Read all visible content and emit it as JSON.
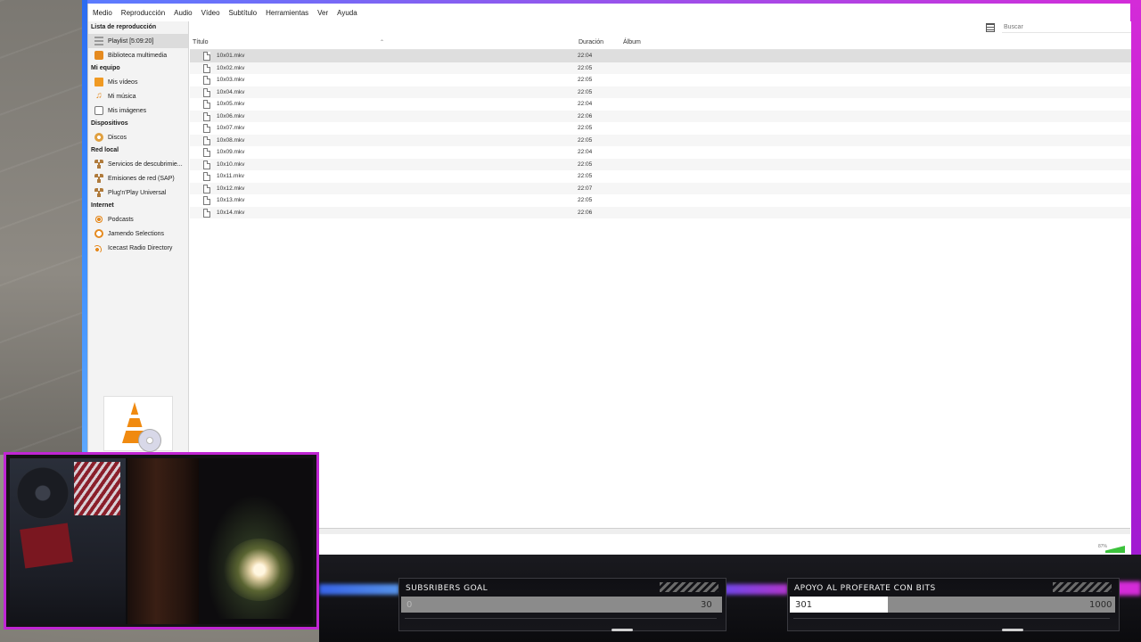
{
  "menubar": [
    "Medio",
    "Reproducción",
    "Audio",
    "Vídeo",
    "Subtítulo",
    "Herramientas",
    "Ver",
    "Ayuda"
  ],
  "sidebar": {
    "sections": [
      {
        "title": "Lista de reproducción",
        "items": [
          {
            "label": "Playlist [5:09:20]",
            "icon": "playlist-icon",
            "selected": true
          },
          {
            "label": "Biblioteca multimedia",
            "icon": "library-icon",
            "selected": false
          }
        ]
      },
      {
        "title": "Mi equipo",
        "items": [
          {
            "label": "Mis vídeos",
            "icon": "videos-icon"
          },
          {
            "label": "Mi música",
            "icon": "music-icon"
          },
          {
            "label": "Mis imágenes",
            "icon": "images-icon"
          }
        ]
      },
      {
        "title": "Dispositivos",
        "items": [
          {
            "label": "Discos",
            "icon": "disc-icon"
          }
        ]
      },
      {
        "title": "Red local",
        "items": [
          {
            "label": "Servicios de descubrimie...",
            "icon": "network-icon"
          },
          {
            "label": "Emisiones de red (SAP)",
            "icon": "network-icon"
          },
          {
            "label": "Plug'n'Play Universal",
            "icon": "network-icon"
          }
        ]
      },
      {
        "title": "Internet",
        "items": [
          {
            "label": "Podcasts",
            "icon": "podcast-icon"
          },
          {
            "label": "Jamendo Selections",
            "icon": "jamendo-icon"
          },
          {
            "label": "Icecast Radio Directory",
            "icon": "icecast-icon"
          }
        ]
      }
    ]
  },
  "search": {
    "placeholder": "Buscar"
  },
  "columns": {
    "title": "Título",
    "duration": "Duración",
    "album": "Álbum"
  },
  "playlist": [
    {
      "title": "10x01.mkv",
      "duration": "22:04"
    },
    {
      "title": "10x02.mkv",
      "duration": "22:05"
    },
    {
      "title": "10x03.mkv",
      "duration": "22:05"
    },
    {
      "title": "10x04.mkv",
      "duration": "22:05"
    },
    {
      "title": "10x05.mkv",
      "duration": "22:04"
    },
    {
      "title": "10x06.mkv",
      "duration": "22:06"
    },
    {
      "title": "10x07.mkv",
      "duration": "22:05"
    },
    {
      "title": "10x08.mkv",
      "duration": "22:05"
    },
    {
      "title": "10x09.mkv",
      "duration": "22:04"
    },
    {
      "title": "10x10.mkv",
      "duration": "22:05"
    },
    {
      "title": "10x11.mkv",
      "duration": "22:05"
    },
    {
      "title": "10x12.mkv",
      "duration": "22:07"
    },
    {
      "title": "10x13.mkv",
      "duration": "22:05"
    },
    {
      "title": "10x14.mkv",
      "duration": "22:06"
    }
  ],
  "volume": {
    "percent_label": "87%"
  },
  "overlays": {
    "subs_goal": {
      "title": "SUBSRIBERS GOAL",
      "current": "0",
      "target": "30",
      "progress": 0
    },
    "bits_goal": {
      "title": "APOYO AL PROFERATE CON BITS",
      "current": "301",
      "target": "1000",
      "progress": 0.301
    }
  },
  "colors": {
    "frame_accent": "#d42bd8",
    "vlc_orange": "#f08a10"
  }
}
